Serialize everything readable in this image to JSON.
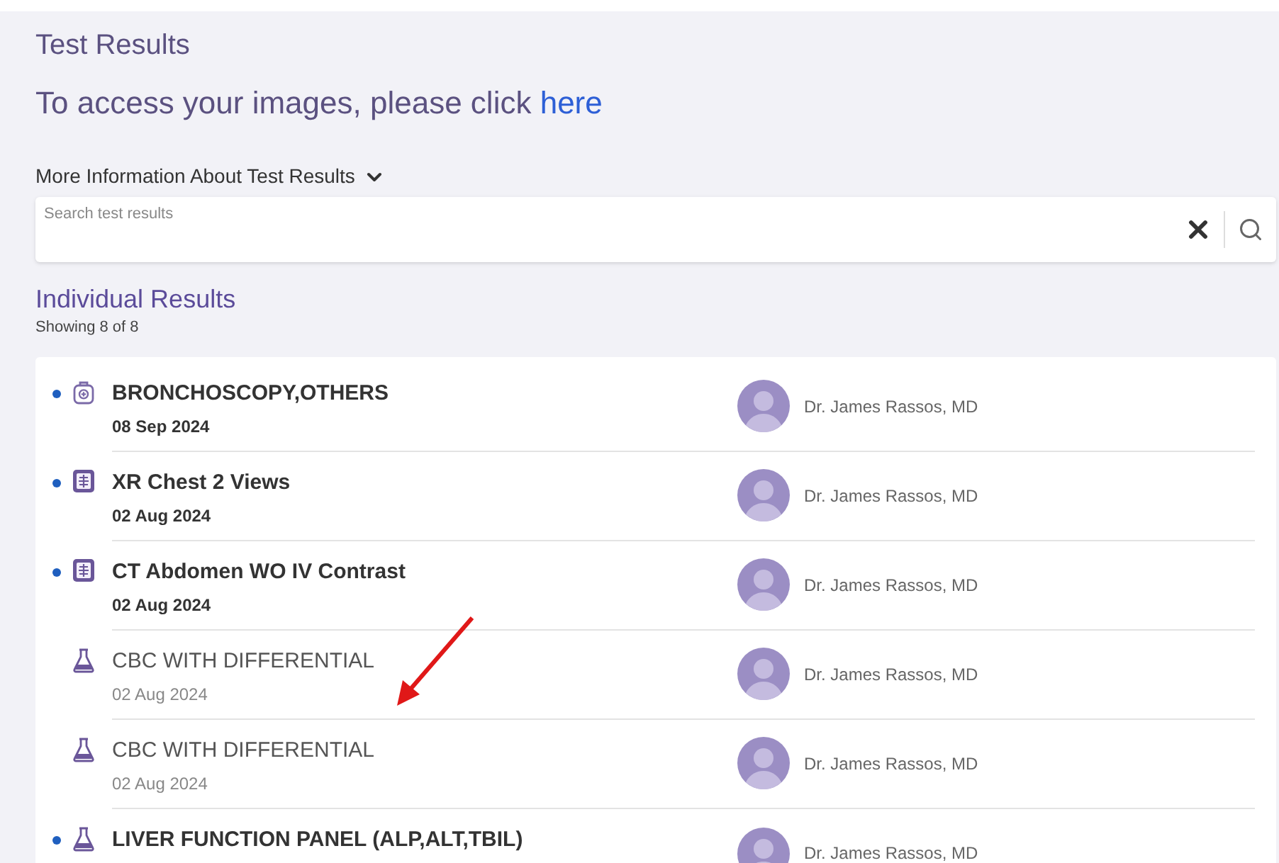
{
  "header": {
    "title": "Test Results",
    "access_text": "To access your images, please click ",
    "access_link": "here"
  },
  "more_info": {
    "label": "More Information About Test Results",
    "expanded": false
  },
  "search": {
    "placeholder": "Search test results"
  },
  "results": {
    "title": "Individual Results",
    "count": "Showing 8 of 8",
    "rows": [
      {
        "kind": "procedure",
        "unread": true,
        "name": "BRONCHOSCOPY,OTHERS",
        "date": "08 Sep 2024",
        "doctor": "Dr. James Rassos, MD"
      },
      {
        "kind": "imaging",
        "unread": true,
        "name": "XR Chest 2 Views",
        "date": "02 Aug 2024",
        "doctor": "Dr. James Rassos, MD"
      },
      {
        "kind": "imaging",
        "unread": true,
        "name": "CT Abdomen WO IV Contrast",
        "date": "02 Aug 2024",
        "doctor": "Dr. James Rassos, MD"
      },
      {
        "kind": "lab",
        "unread": false,
        "name": "CBC WITH DIFFERENTIAL",
        "date": "02 Aug 2024",
        "doctor": "Dr. James Rassos, MD"
      },
      {
        "kind": "lab",
        "unread": false,
        "name": "CBC WITH DIFFERENTIAL",
        "date": "02 Aug 2024",
        "doctor": "Dr. James Rassos, MD"
      },
      {
        "kind": "lab",
        "unread": true,
        "name": "LIVER FUNCTION PANEL (ALP,ALT,TBIL)",
        "doctor": "Dr. James Rassos, MD"
      }
    ]
  }
}
